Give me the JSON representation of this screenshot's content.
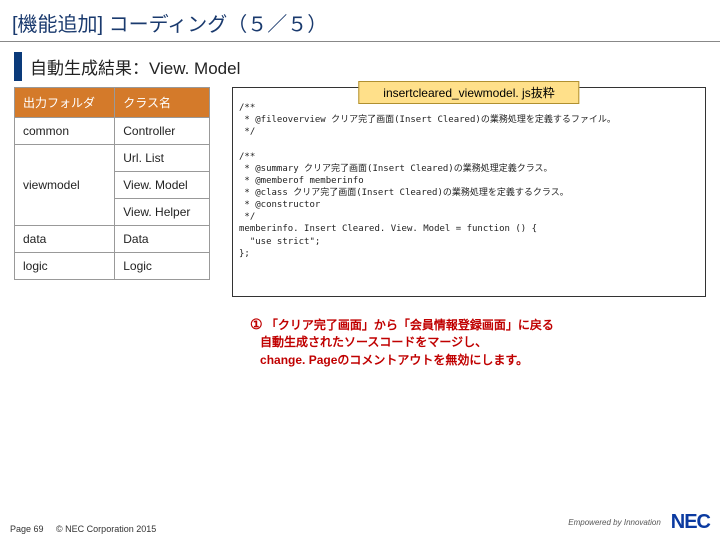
{
  "title": "[機能追加] コーディング（５／５）",
  "subtitle": "自動生成結果：View. Model",
  "table": {
    "headers": {
      "folder": "出力フォルダ",
      "class": "クラス名"
    },
    "rows": [
      {
        "folder": "common",
        "class": "Controller"
      },
      {
        "folder": "",
        "class": "Url. List"
      },
      {
        "folder": "viewmodel",
        "class": "View. Model"
      },
      {
        "folder": "",
        "class": "View. Helper"
      },
      {
        "folder": "data",
        "class": "Data"
      },
      {
        "folder": "logic",
        "class": "Logic"
      }
    ]
  },
  "code": {
    "label": "insertcleared_viewmodel. js抜粋",
    "block1": "/**\n * @fileoverview クリア完了画面(Insert Cleared)の業務処理を定義するファイル。\n */",
    "block2": "/**\n * @summary クリア完了画面(Insert Cleared)の業務処理定義クラス。\n * @memberof memberinfo\n * @class クリア完了画面(Insert Cleared)の業務処理を定義するクラス。\n * @constructor\n */\nmemberinfo. Insert Cleared. View. Model = function () {\n  \"use strict\";\n};"
  },
  "callout": {
    "num": "①",
    "line1": "「クリア完了画面」から「会員情報登録画面」に戻る",
    "line2": "自動生成されたソースコードをマージし、",
    "line3": "change. Pageのコメントアウトを無効にします。"
  },
  "footer": {
    "page": "Page 69",
    "copyright": "© NEC Corporation 2015",
    "tagline": "Empowered by Innovation",
    "logo": "NEC"
  }
}
